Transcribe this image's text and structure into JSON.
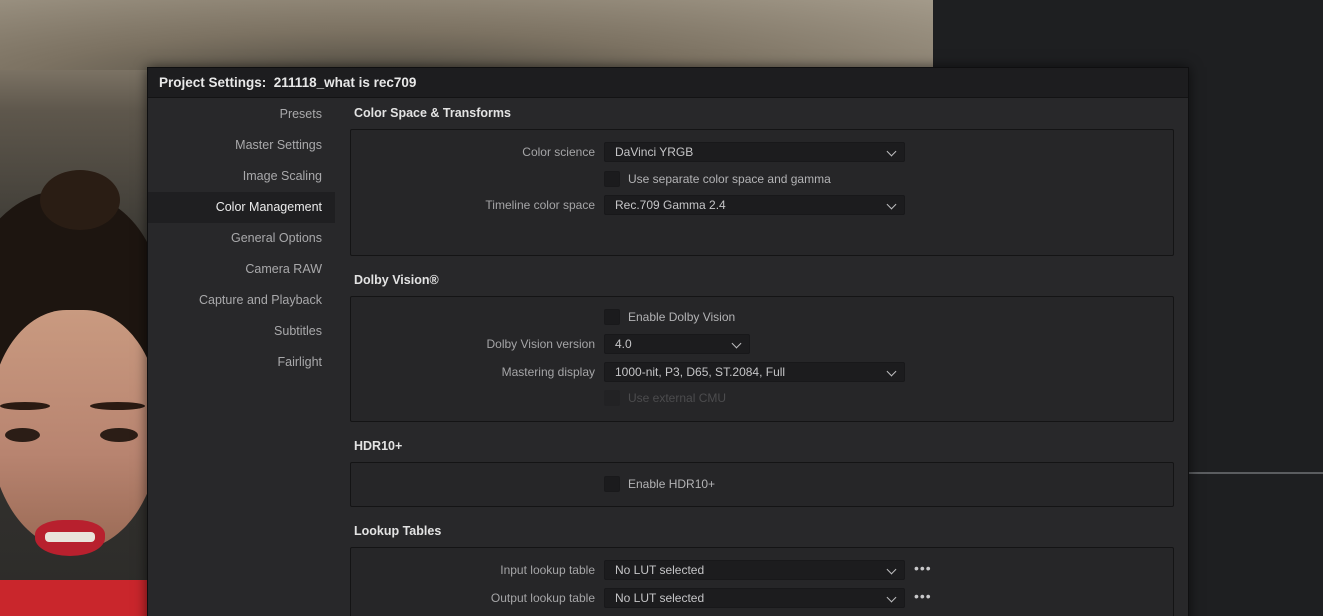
{
  "dialog": {
    "title": "Project Settings:  211118_what is rec709"
  },
  "sidebar": {
    "items": [
      {
        "label": "Presets"
      },
      {
        "label": "Master Settings"
      },
      {
        "label": "Image Scaling"
      },
      {
        "label": "Color Management",
        "active": true
      },
      {
        "label": "General Options"
      },
      {
        "label": "Camera RAW"
      },
      {
        "label": "Capture and Playback"
      },
      {
        "label": "Subtitles"
      },
      {
        "label": "Fairlight"
      }
    ]
  },
  "color_space": {
    "title": "Color Space & Transforms",
    "color_science_label": "Color science",
    "color_science_value": "DaVinci YRGB",
    "separate_label": "Use separate color space and gamma",
    "separate_checked": false,
    "timeline_label": "Timeline color space",
    "timeline_value": "Rec.709 Gamma 2.4"
  },
  "dolby": {
    "title": "Dolby Vision®",
    "enable_label": "Enable Dolby Vision",
    "enable_checked": false,
    "version_label": "Dolby Vision version",
    "version_value": "4.0",
    "mastering_label": "Mastering display",
    "mastering_value": "1000-nit, P3, D65, ST.2084, Full",
    "external_cmu_label": "Use external CMU",
    "external_cmu_disabled": true
  },
  "hdr10": {
    "title": "HDR10+",
    "enable_label": "Enable HDR10+",
    "enable_checked": false
  },
  "lut": {
    "title": "Lookup Tables",
    "input_label": "Input lookup table",
    "input_value": "No LUT selected",
    "output_label": "Output lookup table",
    "output_value": "No LUT selected",
    "more_symbol": "•••"
  },
  "icons": {
    "dropdown": "chevron-down-icon",
    "more": "more-options-icon"
  },
  "colors": {
    "dialog_bg": "#28282a",
    "titlebar_bg": "#1d1d1f",
    "active_item_bg": "#1f1f21"
  }
}
